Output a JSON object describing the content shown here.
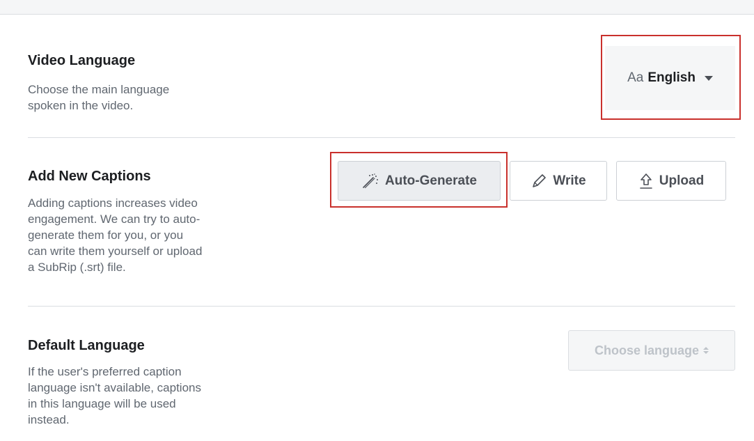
{
  "video_language": {
    "title": "Video Language",
    "description_lines": [
      "Choose the main language",
      "spoken in the video."
    ],
    "selector": {
      "prefix": "Aa",
      "value": "English"
    }
  },
  "add_captions": {
    "title": "Add New Captions",
    "description_lines": [
      "Adding captions increases video",
      "engagement. We can try to auto-",
      "generate them for you, or you",
      "can write them yourself or upload",
      "a SubRip (.srt) file."
    ],
    "buttons": {
      "auto_generate": "Auto-Generate",
      "write": "Write",
      "upload": "Upload"
    }
  },
  "default_language": {
    "title": "Default Language",
    "description_lines": [
      "If the user's preferred caption",
      "language isn't available, captions",
      "in this language will be used",
      "instead."
    ],
    "selector_placeholder": "Choose language"
  },
  "colors": {
    "highlight": "#c9302c",
    "divider": "#dadde1",
    "muted_text": "#606770"
  },
  "icons": {
    "auto_generate": "magic-wand-icon",
    "write": "pencil-icon",
    "upload": "upload-icon"
  }
}
